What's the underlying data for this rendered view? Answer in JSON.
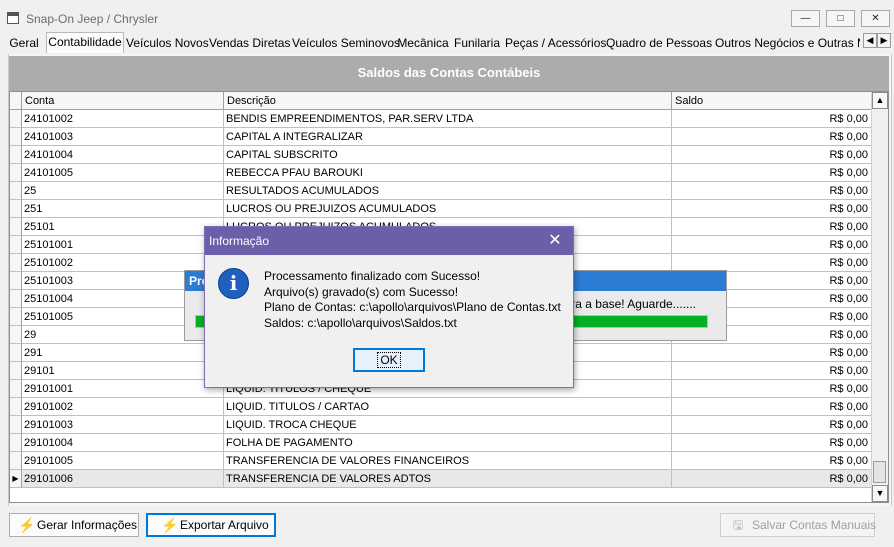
{
  "window": {
    "title": "Snap-On Jeep / Chrysler",
    "buttons": {
      "minimize": "—",
      "maximize": "□",
      "close": "✕"
    }
  },
  "tabs": [
    {
      "label": "Geral",
      "active": false
    },
    {
      "label": "Contabilidade",
      "active": true
    },
    {
      "label": "Veículos Novos",
      "active": false
    },
    {
      "label": "Vendas Diretas",
      "active": false
    },
    {
      "label": "Veículos Seminovos",
      "active": false
    },
    {
      "label": "Mecânica",
      "active": false
    },
    {
      "label": "Funilaria",
      "active": false
    },
    {
      "label": "Peças / Acessórios",
      "active": false
    },
    {
      "label": "Quadro de Pessoas",
      "active": false
    },
    {
      "label": "Outros Negócios e Outras Mar",
      "active": false
    }
  ],
  "tab_scroll": {
    "left": "◀",
    "right": "▶"
  },
  "panel": {
    "title": "Saldos das Contas Contábeis"
  },
  "grid": {
    "columns": [
      "Conta",
      "Descrição",
      "Saldo"
    ],
    "rows": [
      {
        "conta": "24101002",
        "descricao": "BENDIS EMPREENDIMENTOS, PAR.SERV LTDA",
        "saldo": "R$ 0,00"
      },
      {
        "conta": "24101003",
        "descricao": "CAPITAL A INTEGRALIZAR",
        "saldo": "R$ 0,00"
      },
      {
        "conta": "24101004",
        "descricao": "CAPITAL SUBSCRITO",
        "saldo": "R$ 0,00"
      },
      {
        "conta": "24101005",
        "descricao": "REBECCA PFAU BAROUKI",
        "saldo": "R$ 0,00"
      },
      {
        "conta": "25",
        "descricao": "RESULTADOS ACUMULADOS",
        "saldo": "R$ 0,00"
      },
      {
        "conta": "251",
        "descricao": "LUCROS OU PREJUIZOS ACUMULADOS",
        "saldo": "R$ 0,00"
      },
      {
        "conta": "25101",
        "descricao": "LUCROS OU PREJUIZOS ACUMULADOS",
        "saldo": "R$ 0,00"
      },
      {
        "conta": "25101001",
        "descricao": "",
        "saldo": "R$ 0,00"
      },
      {
        "conta": "25101002",
        "descricao": "",
        "saldo": "R$ 0,00"
      },
      {
        "conta": "25101003",
        "descricao": "",
        "saldo": "R$ 0,00"
      },
      {
        "conta": "25101004",
        "descricao": "",
        "saldo": "R$ 0,00"
      },
      {
        "conta": "25101005",
        "descricao": "",
        "saldo": "R$ 0,00"
      },
      {
        "conta": "29",
        "descricao": "",
        "saldo": "R$ 0,00"
      },
      {
        "conta": "291",
        "descricao": "",
        "saldo": "R$ 0,00"
      },
      {
        "conta": "29101",
        "descricao": "",
        "saldo": "R$ 0,00"
      },
      {
        "conta": "29101001",
        "descricao": "LIQUID. TITULOS / CHEQUE",
        "saldo": "R$ 0,00"
      },
      {
        "conta": "29101002",
        "descricao": "LIQUID. TITULOS / CARTAO",
        "saldo": "R$ 0,00"
      },
      {
        "conta": "29101003",
        "descricao": "LIQUID. TROCA CHEQUE",
        "saldo": "R$ 0,00"
      },
      {
        "conta": "29101004",
        "descricao": "FOLHA DE PAGAMENTO",
        "saldo": "R$ 0,00"
      },
      {
        "conta": "29101005",
        "descricao": "TRANSFERENCIA DE VALORES FINANCEIROS",
        "saldo": "R$ 0,00"
      },
      {
        "conta": "29101006",
        "descricao": "TRANSFERENCIA DE VALORES ADTOS",
        "saldo": "R$ 0,00",
        "selected": true
      }
    ],
    "selected_indicator": "▶",
    "scroll": {
      "up": "▲",
      "down": "▼"
    }
  },
  "buttons": {
    "gerar": "Gerar Informações",
    "exportar": "Exportar Arquivo",
    "salvar": "Salvar Contas Manuais",
    "bolt_glyph": "⚡",
    "save_glyph": "🖫"
  },
  "background_dialog": {
    "title": "Pro",
    "message": "ara a base! Aguarde.......",
    "progress": 1.0
  },
  "dialog": {
    "title": "Informação",
    "close": "✕",
    "icon_glyph": "i",
    "lines": [
      "Processamento finalizado com Sucesso!",
      "Arquivo(s) gravado(s) com Sucesso!",
      "Plano de Contas: c:\\apollo\\arquivos\\Plano de Contas.txt",
      "Saldos: c:\\apollo\\arquivos\\Saldos.txt"
    ],
    "ok": "OK"
  },
  "colors": {
    "dialog_title": "#6a5fa8",
    "bg_dialog_title": "#2c7bd4",
    "progress_fill": "#06b025",
    "panel_header": "#acacac",
    "focus_border": "#0078d7"
  }
}
